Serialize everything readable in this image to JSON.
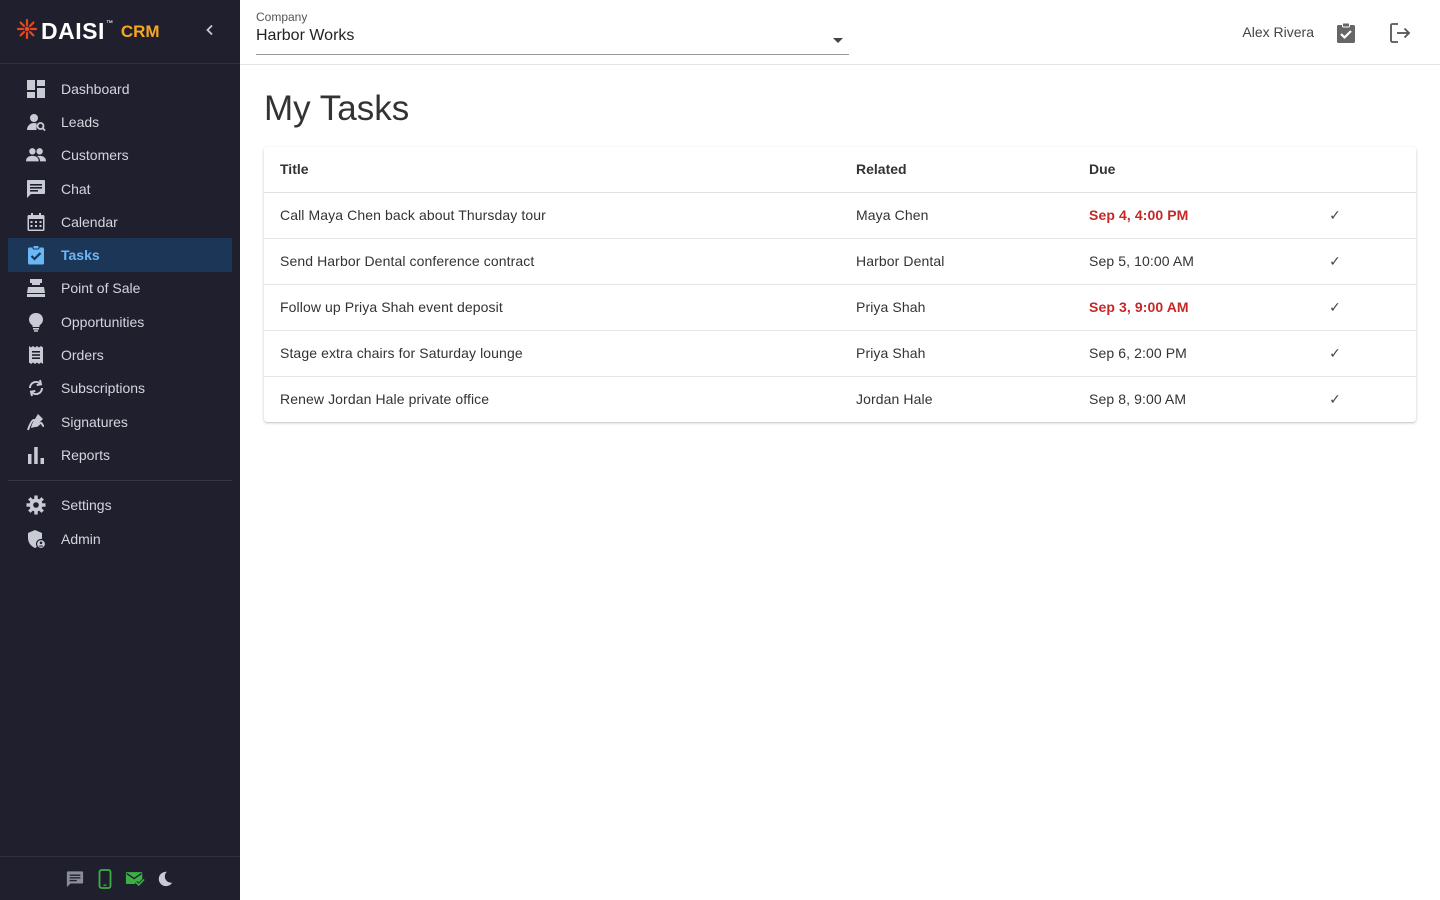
{
  "brand": {
    "name": "DAISI",
    "tm": "™",
    "product": "CRM"
  },
  "colors": {
    "sidebar_bg": "#1f1f2e",
    "active_bg": "#1c3657",
    "active_text": "#6ab7f7",
    "brand_accent": "#f5a623",
    "logo_red": "#e8471f",
    "overdue": "#c62828"
  },
  "sidebar": {
    "items": [
      {
        "label": "Dashboard",
        "icon": "dashboard-icon"
      },
      {
        "label": "Leads",
        "icon": "person-search-icon"
      },
      {
        "label": "Customers",
        "icon": "people-icon"
      },
      {
        "label": "Chat",
        "icon": "chat-icon"
      },
      {
        "label": "Calendar",
        "icon": "calendar-icon"
      },
      {
        "label": "Tasks",
        "icon": "assignment-check-icon",
        "active": true
      },
      {
        "label": "Point of Sale",
        "icon": "cash-register-icon"
      },
      {
        "label": "Opportunities",
        "icon": "lightbulb-icon"
      },
      {
        "label": "Orders",
        "icon": "receipt-icon"
      },
      {
        "label": "Subscriptions",
        "icon": "sync-icon"
      },
      {
        "label": "Signatures",
        "icon": "signature-icon"
      },
      {
        "label": "Reports",
        "icon": "bar-chart-icon"
      }
    ],
    "bottom_items": [
      {
        "label": "Settings",
        "icon": "gear-icon"
      },
      {
        "label": "Admin",
        "icon": "admin-shield-icon"
      }
    ],
    "footer_icons": [
      "message-icon",
      "phone-icon",
      "mail-check-icon",
      "dark-mode-icon"
    ]
  },
  "header": {
    "company_label": "Company",
    "company_value": "Harbor Works",
    "user_name": "Alex Rivera",
    "icons": [
      "tasks-icon",
      "logout-icon"
    ]
  },
  "main": {
    "title": "My Tasks",
    "columns": [
      "Title",
      "Related",
      "Due"
    ],
    "rows": [
      {
        "title": "Call Maya Chen back about Thursday tour",
        "related": "Maya Chen",
        "due": "Sep 4, 4:00 PM",
        "overdue": true,
        "action": "✓"
      },
      {
        "title": "Send Harbor Dental conference contract",
        "related": "Harbor Dental",
        "due": "Sep 5, 10:00 AM",
        "overdue": false,
        "action": "✓"
      },
      {
        "title": "Follow up Priya Shah event deposit",
        "related": "Priya Shah",
        "due": "Sep 3, 9:00 AM",
        "overdue": true,
        "action": "✓"
      },
      {
        "title": "Stage extra chairs for Saturday lounge",
        "related": "Priya Shah",
        "due": "Sep 6, 2:00 PM",
        "overdue": false,
        "action": "✓"
      },
      {
        "title": "Renew Jordan Hale private office",
        "related": "Jordan Hale",
        "due": "Sep 8, 9:00 AM",
        "overdue": false,
        "action": "✓"
      }
    ]
  }
}
